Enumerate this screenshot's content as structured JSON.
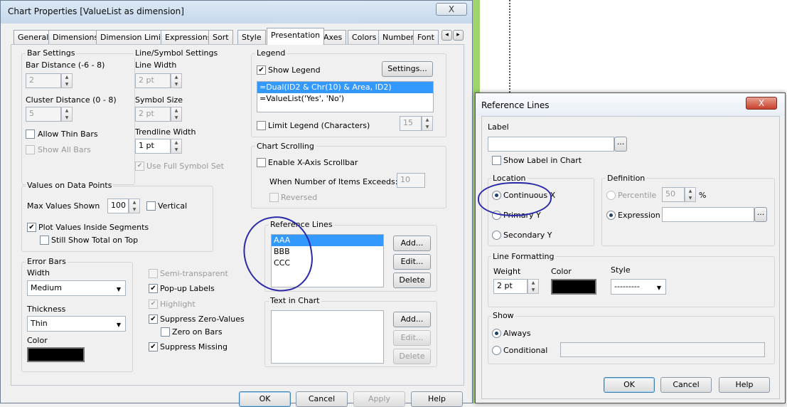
{
  "main": {
    "title": "Chart Properties [ValueList as dimension]",
    "close": "X",
    "tabs": [
      "General",
      "Dimensions",
      "Dimension Limits",
      "Expressions",
      "Sort",
      "Style",
      "Presentation",
      "Axes",
      "Colors",
      "Number",
      "Font"
    ],
    "tab_scroll_left": "◂",
    "tab_scroll_right": "▸",
    "bar_settings": {
      "title": "Bar Settings",
      "bar_distance_label": "Bar Distance (-6 - 8)",
      "bar_distance_value": "2",
      "cluster_distance_label": "Cluster Distance (0 - 8)",
      "cluster_distance_value": "5",
      "allow_thin_bars": "Allow Thin Bars",
      "show_all_bars": "Show All Bars"
    },
    "line_symbol": {
      "title": "Line/Symbol Settings",
      "line_width_label": "Line Width",
      "line_width_value": "2 pt",
      "symbol_size_label": "Symbol Size",
      "symbol_size_value": "2 pt",
      "trendline_width_label": "Trendline Width",
      "trendline_width_value": "1 pt",
      "use_full_symbol_set": "Use Full Symbol Set"
    },
    "values_on_data_points": {
      "title": "Values on Data Points",
      "max_values_label": "Max Values Shown",
      "max_values_value": "100",
      "vertical": "Vertical",
      "plot_inside": "Plot Values Inside Segments",
      "still_show_total": "Still Show Total on Top"
    },
    "error_bars": {
      "title": "Error Bars",
      "width_label": "Width",
      "width_value": "Medium",
      "thickness_label": "Thickness",
      "thickness_value": "Thin",
      "color_label": "Color"
    },
    "options": {
      "semi_transparent": "Semi-transparent",
      "popup_labels": "Pop-up Labels",
      "highlight": "Highlight",
      "suppress_zero": "Suppress Zero-Values",
      "zero_on_bars": "Zero on Bars",
      "suppress_missing": "Suppress Missing"
    },
    "legend": {
      "title": "Legend",
      "show_legend": "Show Legend",
      "settings_button": "Settings...",
      "items": [
        "=Dual(ID2 & Chr(10) & Area, ID2)",
        "=ValueList('Yes', 'No')"
      ],
      "limit_legend": "Limit Legend (Characters)",
      "limit_value": "15"
    },
    "chart_scrolling": {
      "title": "Chart Scrolling",
      "enable_scrollbar": "Enable X-Axis Scrollbar",
      "when_exceeds": "When Number of Items Exceeds:",
      "exceeds_value": "10",
      "reversed": "Reversed"
    },
    "reference_lines": {
      "title": "Reference Lines",
      "items": [
        "AAA",
        "BBB",
        "CCC"
      ],
      "add": "Add...",
      "edit": "Edit...",
      "delete": "Delete"
    },
    "text_in_chart": {
      "title": "Text in Chart",
      "add": "Add...",
      "edit": "Edit...",
      "delete": "Delete"
    },
    "footer": {
      "ok": "OK",
      "cancel": "Cancel",
      "apply": "Apply",
      "help": "Help"
    }
  },
  "ref": {
    "title": "Reference Lines",
    "close": "X",
    "label_title": "Label",
    "label_value": "",
    "browse": "...",
    "show_label": "Show Label in Chart",
    "location": {
      "title": "Location",
      "continuous_x": "Continuous X",
      "primary_y": "Primary Y",
      "secondary_y": "Secondary Y"
    },
    "definition": {
      "title": "Definition",
      "percentile": "Percentile",
      "percentile_value": "50",
      "percent_sign": "%",
      "expression": "Expression",
      "expression_value": ""
    },
    "line_formatting": {
      "title": "Line Formatting",
      "weight_label": "Weight",
      "weight_value": "2 pt",
      "color_label": "Color",
      "style_label": "Style",
      "style_value": "---------"
    },
    "show": {
      "title": "Show",
      "always": "Always",
      "conditional": "Conditional"
    },
    "footer": {
      "ok": "OK",
      "cancel": "Cancel",
      "help": "Help"
    }
  },
  "colors": {
    "accent": "#3399ff",
    "annotation": "#2a2aa8",
    "swatch": "#000000"
  }
}
